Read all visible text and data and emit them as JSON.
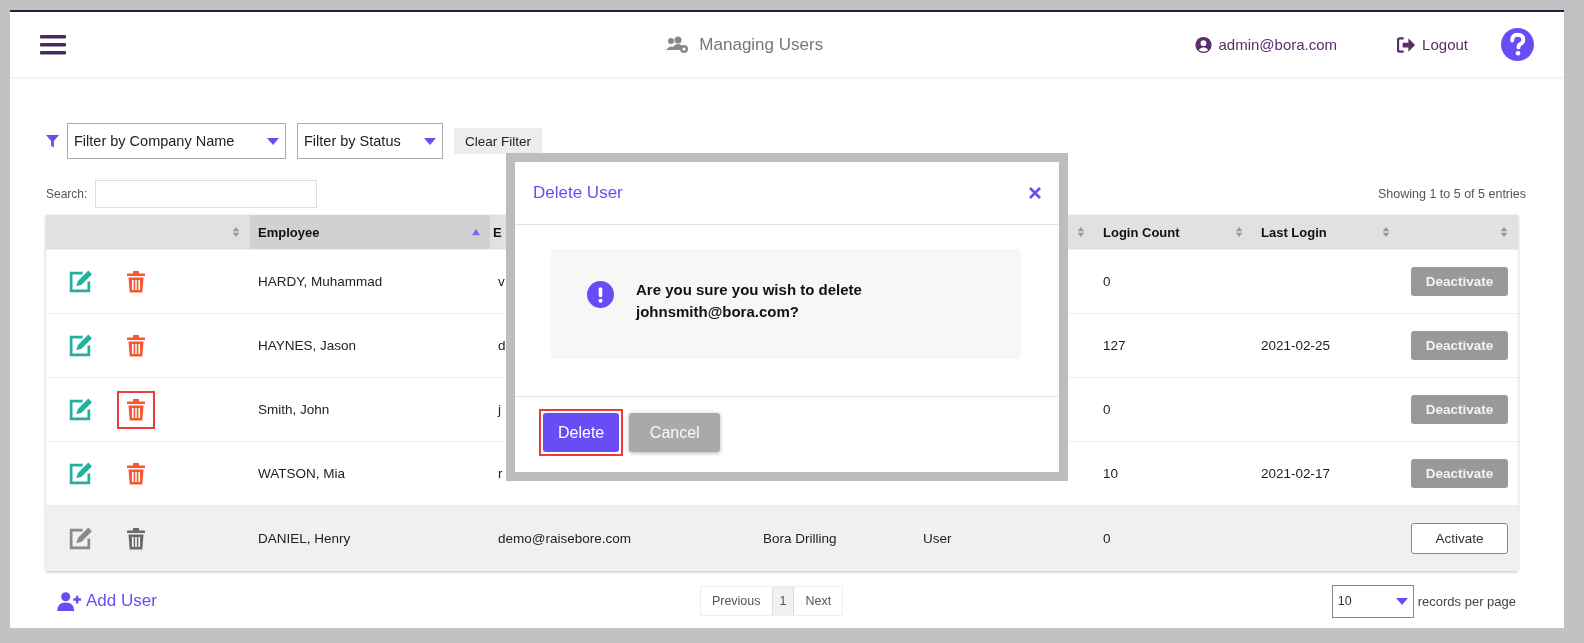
{
  "header": {
    "title": "Managing Users",
    "user": "admin@bora.com",
    "logout": "Logout"
  },
  "filters": {
    "company": {
      "placeholder": "Filter by Company Name"
    },
    "status": {
      "placeholder": "Filter by Status"
    },
    "clear": "Clear Filter"
  },
  "search": {
    "label": "Search:"
  },
  "info": "Showing 1 to 5 of 5 entries",
  "table": {
    "columns": [
      {
        "sorted": false
      },
      {
        "label": "Employee",
        "sorted": true
      },
      {
        "label": "E"
      },
      {},
      {
        "sorted": false
      },
      {
        "label": "Login Count",
        "sorted": false
      },
      {
        "label": "Last Login",
        "sorted": false
      },
      {
        "sorted": false
      }
    ],
    "rows": [
      {
        "employee": "HARDY, Muhammad",
        "email": "v",
        "login_count": "0",
        "active": true,
        "highlighted": false,
        "action": "Deactivate"
      },
      {
        "employee": "HAYNES, Jason",
        "email": "d",
        "login_count": "127",
        "last_login": "2021-02-25",
        "active": true,
        "highlighted": false,
        "action": "Deactivate"
      },
      {
        "employee": "Smith, John",
        "email": "j",
        "login_count": "0",
        "active": true,
        "highlighted": true,
        "action": "Deactivate"
      },
      {
        "employee": "WATSON, Mia",
        "email": "r",
        "login_count": "10",
        "last_login": "2021-02-17",
        "active": true,
        "highlighted": false,
        "action": "Deactivate"
      },
      {
        "employee": "DANIEL, Henry",
        "email": "demo@raisebore.com",
        "company": "Bora Drilling",
        "role": "User",
        "login_count": "0",
        "active": false,
        "highlighted": false,
        "action": "Activate"
      }
    ]
  },
  "add_user": "Add User",
  "pagination": [
    {
      "label": "Previous",
      "selected": false
    },
    {
      "label": "1",
      "selected": true
    },
    {
      "label": "Next",
      "selected": false
    }
  ],
  "page_size": {
    "value": "10",
    "label": "records per page"
  },
  "modal": {
    "title": "Delete User",
    "message": "Are you sure you wish to delete johnsmith@bora.com?",
    "buttons": [
      {
        "label": "Delete",
        "kind": "primary",
        "highlighted": true
      },
      {
        "label": "Cancel",
        "kind": "secondary",
        "highlighted": false
      }
    ]
  }
}
